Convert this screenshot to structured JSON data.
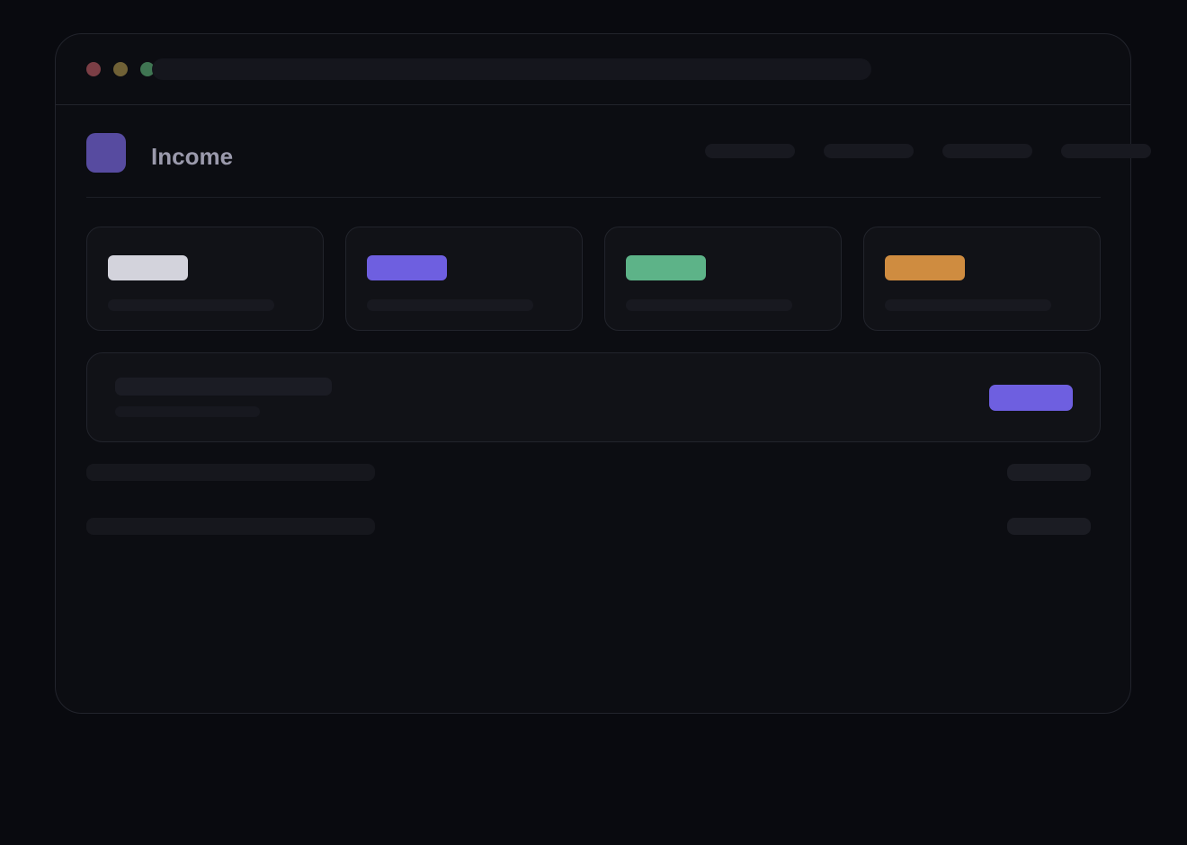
{
  "app": {
    "title": "Income"
  },
  "window": {
    "controls": [
      {
        "name": "close",
        "color": "#7b3e45"
      },
      {
        "name": "minimize",
        "color": "#706136"
      },
      {
        "name": "maximize",
        "color": "#3f7552"
      }
    ]
  },
  "nav": {
    "item_count": 4
  },
  "stats": [
    {
      "accent_color": "#d3d3dc"
    },
    {
      "accent_color": "#6e5fe0"
    },
    {
      "accent_color": "#5db388"
    },
    {
      "accent_color": "#cf8c40"
    }
  ],
  "banner": {
    "action_color": "#6e5fe0"
  },
  "list": {
    "row_count": 2
  },
  "colors": {
    "background": "#090a0f",
    "window": "#0c0d12",
    "card": "#111217",
    "border": "#22242c",
    "logo": "#574ba0",
    "title_text": "#9b9aac"
  }
}
